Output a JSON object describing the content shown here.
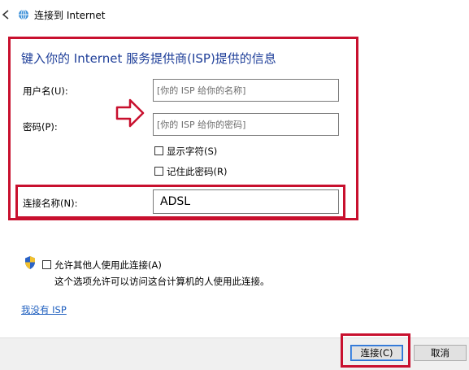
{
  "window": {
    "title": "连接到 Internet"
  },
  "form": {
    "heading": "键入你的 Internet 服务提供商(ISP)提供的信息",
    "username": {
      "label": "用户名(U):",
      "placeholder": "[你的 ISP 给你的名称]"
    },
    "password": {
      "label": "密码(P):",
      "placeholder": "[你的 ISP 给你的密码]"
    },
    "show_chars": {
      "label": "显示字符(S)",
      "checked": false
    },
    "remember_password": {
      "label": "记住此密码(R)",
      "checked": false
    },
    "connection_name": {
      "label": "连接名称(N):",
      "value": "ADSL"
    }
  },
  "sharing": {
    "allow_label": "允许其他人使用此连接(A)",
    "description": "这个选项允许可以访问这台计算机的人使用此连接。",
    "checked": false
  },
  "no_isp_link": "我没有 ISP",
  "buttons": {
    "connect": "连接(C)",
    "cancel": "取消"
  },
  "colors": {
    "highlight_box": "#c8102e",
    "heading": "#1f3f99",
    "link": "#1f5fbf",
    "arrow": "#c8102e"
  }
}
